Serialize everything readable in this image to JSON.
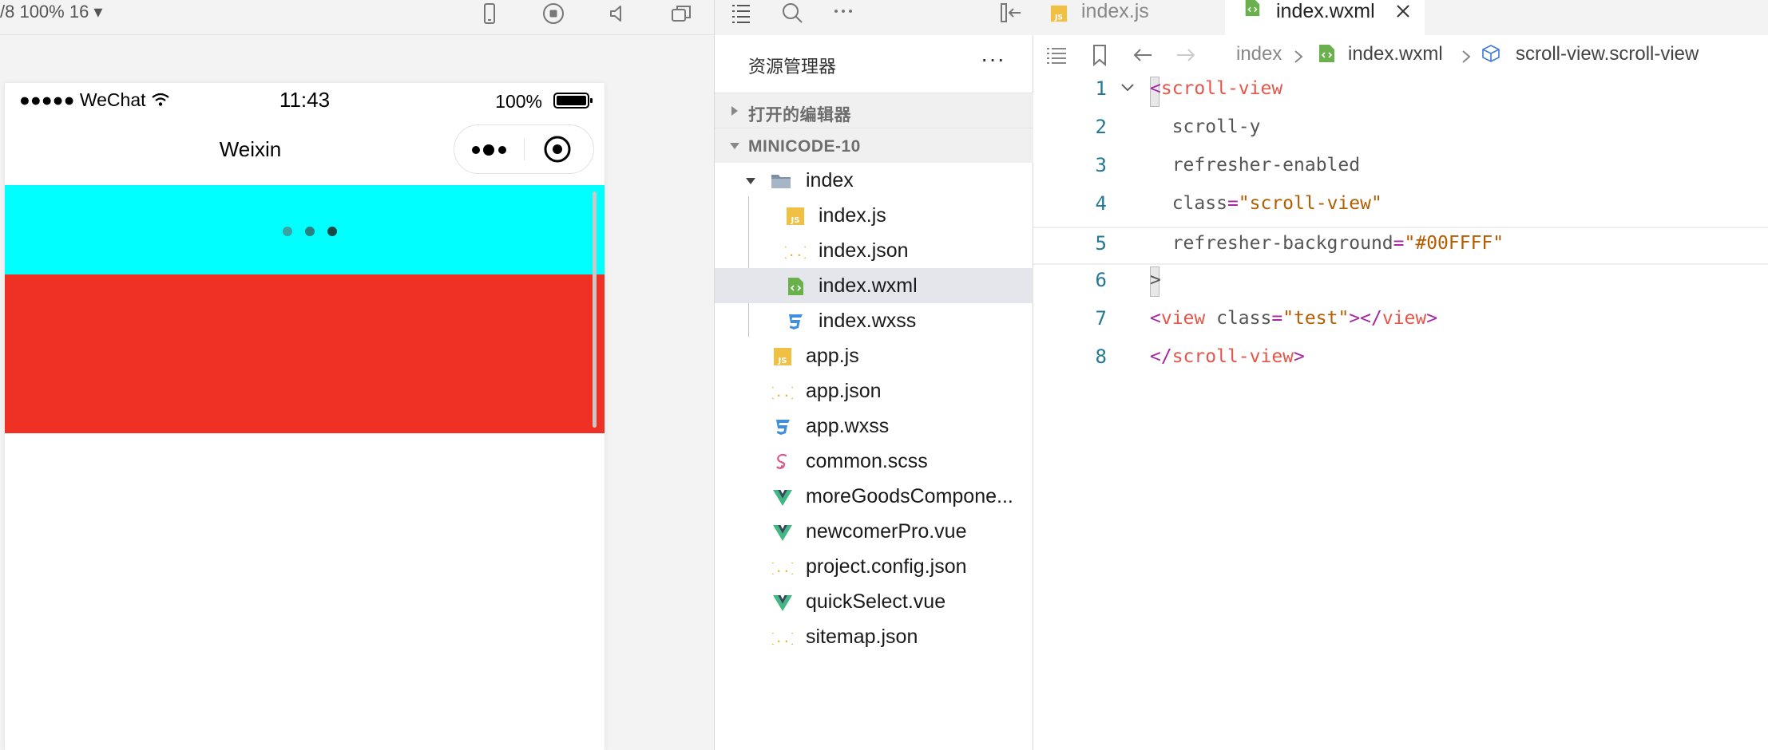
{
  "simulator": {
    "device_text": "/8 100% 16 ▾",
    "status": {
      "carrier": "●●●●● WeChat",
      "time": "11:43",
      "battery": "100%"
    },
    "nav_title": "Weixin",
    "refresher_background": "#00FFFF",
    "block_color": "#EE3124"
  },
  "explorer": {
    "title": "资源管理器",
    "more": "···",
    "sections": {
      "open_editors": "打开的编辑器",
      "project": "MINICODE-10"
    },
    "tree": [
      {
        "name": "index",
        "icon": "folder-icon"
      },
      {
        "name": "index.js",
        "icon": "js-file-icon"
      },
      {
        "name": "index.json",
        "icon": "json-file-icon"
      },
      {
        "name": "index.wxml",
        "icon": "wxml-file-icon"
      },
      {
        "name": "index.wxss",
        "icon": "css-file-icon"
      },
      {
        "name": "app.js",
        "icon": "js-file-icon"
      },
      {
        "name": "app.json",
        "icon": "json-file-icon"
      },
      {
        "name": "app.wxss",
        "icon": "css-file-icon"
      },
      {
        "name": "common.scss",
        "icon": "sass-file-icon"
      },
      {
        "name": "moreGoodsCompone...",
        "icon": "vue-file-icon"
      },
      {
        "name": "newcomerPro.vue",
        "icon": "vue-file-icon"
      },
      {
        "name": "project.config.json",
        "icon": "json-file-icon"
      },
      {
        "name": "quickSelect.vue",
        "icon": "vue-file-icon"
      },
      {
        "name": "sitemap.json",
        "icon": "json-file-icon"
      }
    ]
  },
  "editor": {
    "tabs": [
      {
        "label": "index.js",
        "active": false
      },
      {
        "label": "index.wxml",
        "active": true
      }
    ],
    "breadcrumb": [
      "index",
      "index.wxml",
      "scroll-view.scroll-view"
    ],
    "line_numbers": [
      "1",
      "2",
      "3",
      "4",
      "5",
      "6",
      "7",
      "8"
    ],
    "code": {
      "l1_lt": "<",
      "l1_tag": "scroll-view",
      "l2": "  scroll-y",
      "l3": "  refresher-enabled",
      "l4_attr": "  class",
      "l4_eq": "=",
      "l4_val": "\"scroll-view\"",
      "l5_attr": "  refresher-background",
      "l5_eq": "=",
      "l5_val": "\"#00FFFF\"",
      "l6": ">",
      "l7_lt": "<",
      "l7_tag": "view",
      "l7_attr": " class",
      "l7_eq": "=",
      "l7_val": "\"test\"",
      "l7_close1": "></",
      "l7_tag2": "view",
      "l7_close2": ">",
      "l8_lt": "</",
      "l8_tag": "scroll-view",
      "l8_gt": ">"
    }
  }
}
